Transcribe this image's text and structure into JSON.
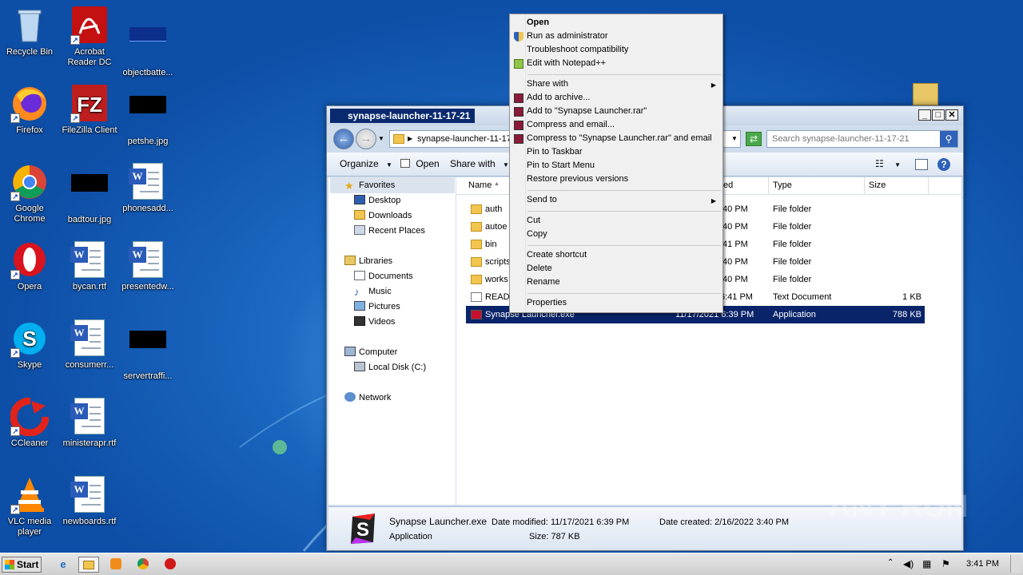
{
  "desktop": {
    "icons": [
      {
        "label": "Recycle Bin"
      },
      {
        "label": "Acrobat Reader DC"
      },
      {
        "label": "objectbatte..."
      },
      {
        "label": "Firefox"
      },
      {
        "label": "FileZilla Client"
      },
      {
        "label": "petshe.jpg"
      },
      {
        "label": "Google Chrome"
      },
      {
        "label": "badtour.jpg"
      },
      {
        "label": "phonesadd..."
      },
      {
        "label": "Opera"
      },
      {
        "label": "bycan.rtf"
      },
      {
        "label": "presentedw..."
      },
      {
        "label": "Skype"
      },
      {
        "label": "consumerr..."
      },
      {
        "label": "servertraffi..."
      },
      {
        "label": "CCleaner"
      },
      {
        "label": "ministerapr.rtf"
      },
      {
        "label": "VLC media player"
      },
      {
        "label": "newboards.rtf"
      }
    ],
    "watermark": "ANY RUN"
  },
  "explorer": {
    "title": "synapse-launcher-11-17-21",
    "address": "synapse-launcher-11-17",
    "search_placeholder": "Search synapse-launcher-11-17-21",
    "toolbar": {
      "organize": "Organize",
      "open": "Open",
      "share_with": "Share with"
    },
    "nav": {
      "favorites": "Favorites",
      "desktop": "Desktop",
      "downloads": "Downloads",
      "recent": "Recent Places",
      "libraries": "Libraries",
      "documents": "Documents",
      "music": "Music",
      "pictures": "Pictures",
      "videos": "Videos",
      "computer": "Computer",
      "local_disk": "Local Disk (C:)",
      "network": "Network"
    },
    "columns": {
      "name": "Name",
      "date": "ed",
      "type": "Type",
      "size": "Size"
    },
    "files": [
      {
        "name": "auth",
        "date": ":40 PM",
        "type": "File folder",
        "size": ""
      },
      {
        "name": "autoe",
        "date": ":40 PM",
        "type": "File folder",
        "size": ""
      },
      {
        "name": "bin",
        "date": ":41 PM",
        "type": "File folder",
        "size": ""
      },
      {
        "name": "scripts",
        "date": ":40 PM",
        "type": "File folder",
        "size": ""
      },
      {
        "name": "works",
        "date": ":40 PM",
        "type": "File folder",
        "size": ""
      },
      {
        "name": "READ",
        "date": "6:41 PM",
        "type": "Text Document",
        "size": "1 KB"
      },
      {
        "name": "Synapse Launcher.exe",
        "date": "11/17/2021 6:39 PM",
        "type": "Application",
        "size": "788 KB"
      }
    ],
    "details": {
      "filename": "Synapse Launcher.exe",
      "modified": "Date modified: 11/17/2021 6:39 PM",
      "created": "Date created: 2/16/2022 3:40 PM",
      "kind": "Application",
      "size": "Size: 787 KB"
    }
  },
  "context_menu": {
    "items": [
      "Open",
      "Run as administrator",
      "Troubleshoot compatibility",
      "Edit with Notepad++",
      "Share with",
      "Add to archive...",
      "Add to \"Synapse Launcher.rar\"",
      "Compress and email...",
      "Compress to \"Synapse Launcher.rar\" and email",
      "Pin to Taskbar",
      "Pin to Start Menu",
      "Restore previous versions",
      "Send to",
      "Cut",
      "Copy",
      "Create shortcut",
      "Delete",
      "Rename",
      "Properties"
    ]
  },
  "taskbar": {
    "start": "Start",
    "clock": "3:41 PM"
  },
  "colors": {
    "selection": "#0a246a",
    "desktop_blue": "#1a66c0",
    "titlebar_active": "#0a2a6f"
  }
}
